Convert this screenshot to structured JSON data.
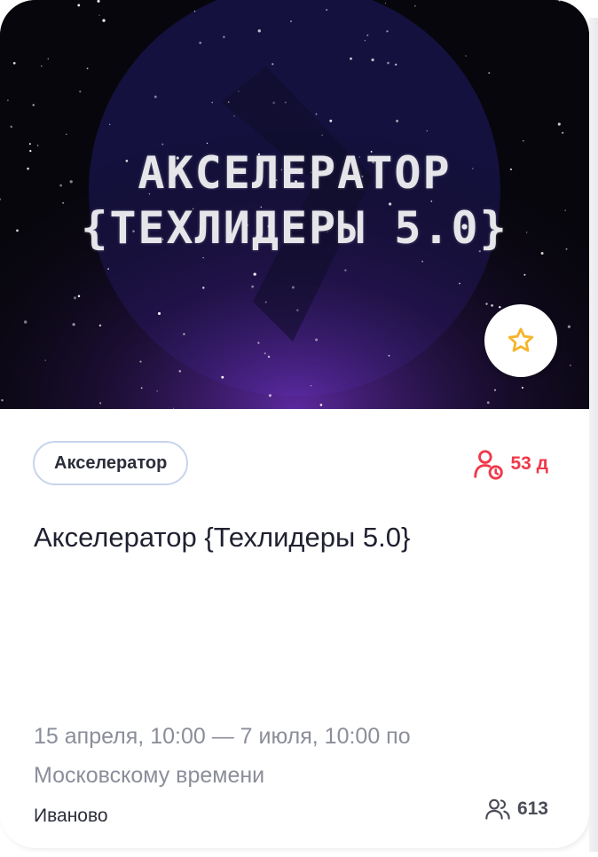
{
  "banner": {
    "line1": "АКСЕЛЕРАТОР",
    "line2": "{ТЕХЛИДЕРЫ 5.0}"
  },
  "favorite": {
    "icon": "star-icon",
    "color": "#f5b42a"
  },
  "tag": {
    "label": "Акселератор"
  },
  "deadline": {
    "icon": "user-clock-icon",
    "text": "53 д",
    "color": "#f0384a"
  },
  "event": {
    "title": "Акселератор {Техлидеры 5.0}",
    "dates_line1": "15 апреля, 10:00 — 7 июля, 10:00 по",
    "dates_line2": "Московскому времени",
    "city": "Иваново"
  },
  "participants": {
    "icon": "users-icon",
    "count": "613"
  }
}
